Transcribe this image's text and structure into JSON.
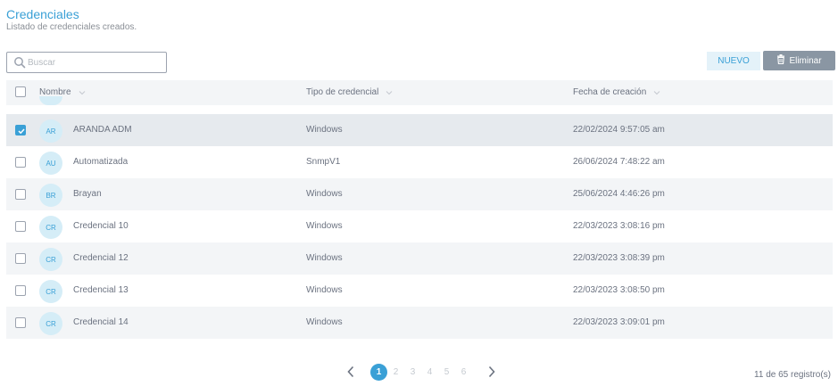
{
  "page": {
    "title": "Credenciales",
    "subtitle": "Listado de credenciales creados."
  },
  "toolbar": {
    "search_placeholder": "Buscar",
    "new_label": "NUEVO",
    "delete_label": "Eliminar"
  },
  "colors": {
    "accent": "#3aa0d6",
    "delete_button": "#8a96a3",
    "header_bg": "#f3f5f7"
  },
  "table": {
    "columns": [
      "Nombre",
      "Tipo de credencial",
      "Fecha de creación"
    ],
    "rows": [
      {
        "initials": "AR",
        "name": "ARANDA ADM",
        "type": "Windows",
        "date": "22/02/2024 9:57:05 am",
        "checked": true
      },
      {
        "initials": "AU",
        "name": "Automatizada",
        "type": "SnmpV1",
        "date": "26/06/2024 7:48:22 am",
        "checked": false
      },
      {
        "initials": "BR",
        "name": "Brayan",
        "type": "Windows",
        "date": "25/06/2024 4:46:26 pm",
        "checked": false
      },
      {
        "initials": "CR",
        "name": "Credencial 10",
        "type": "Windows",
        "date": "22/03/2023 3:08:16 pm",
        "checked": false
      },
      {
        "initials": "CR",
        "name": "Credencial 12",
        "type": "Windows",
        "date": "22/03/2023 3:08:39 pm",
        "checked": false
      },
      {
        "initials": "CR",
        "name": "Credencial 13",
        "type": "Windows",
        "date": "22/03/2023 3:08:50 pm",
        "checked": false
      },
      {
        "initials": "CR",
        "name": "Credencial 14",
        "type": "Windows",
        "date": "22/03/2023 3:09:01 pm",
        "checked": false
      }
    ]
  },
  "pagination": {
    "pages": [
      "1",
      "2",
      "3",
      "4",
      "5",
      "6"
    ],
    "current": "1",
    "records": "11 de 65 registro(s)"
  }
}
